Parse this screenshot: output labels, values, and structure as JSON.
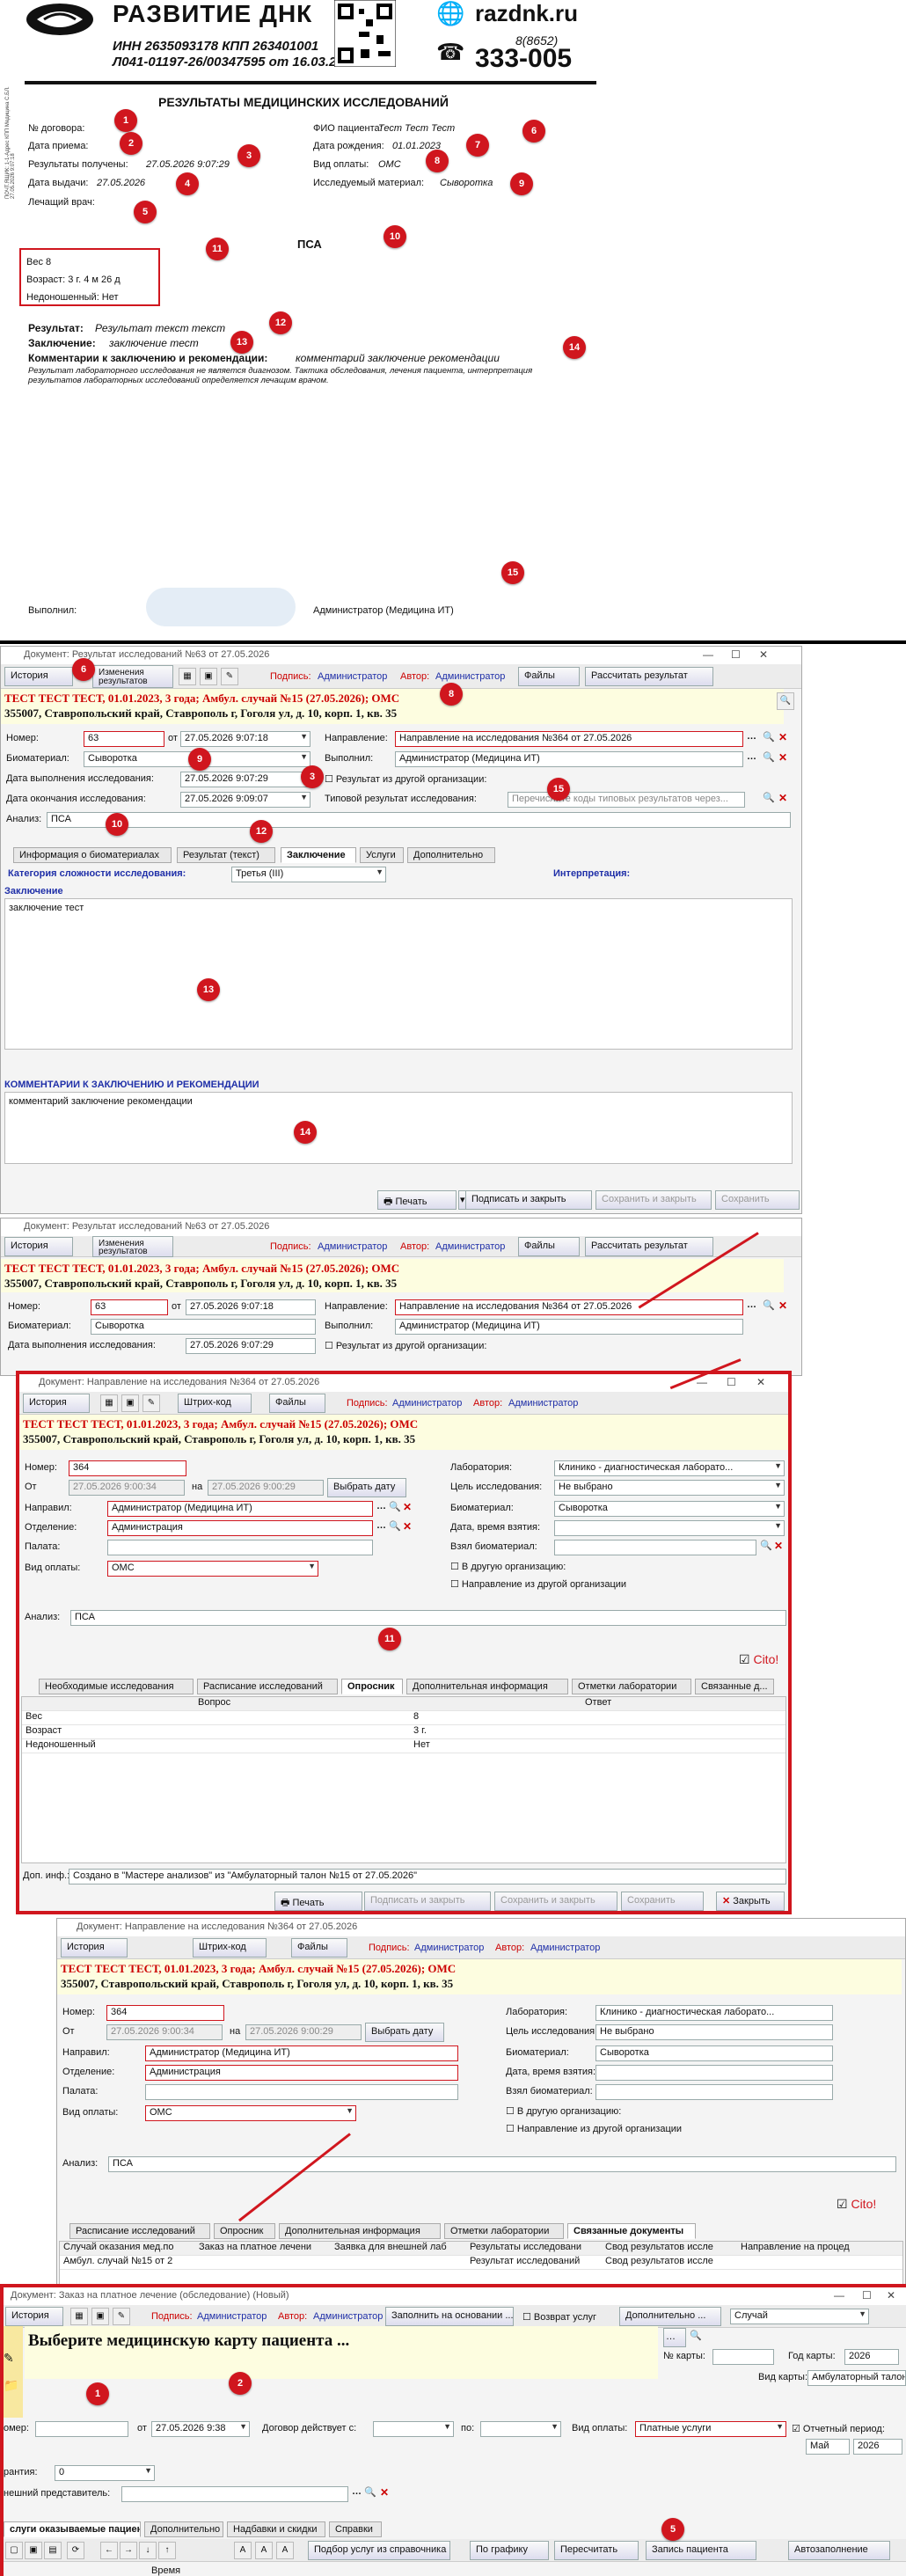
{
  "doc": {
    "brand": "РАЗВИТИЕ ДНК",
    "inn": "ИНН 2635093178 КПП 263401001",
    "license": "Л041-01197-26/00347595 от 16.03.2020г.",
    "site": "razdnk.ru",
    "phone_code": "8(8652)",
    "phone": "333-005",
    "title": "РЕЗУЛЬТАТЫ МЕДИЦИНСКИХ ИССЛЕДОВАНИЙ",
    "side_text": "ПОЧТ.ЯЩИК: 1-1-Адрес КПП Медицина С.БЛ. 27.05.2026 9:07:18",
    "l_contract": "№ договора:",
    "l_date_recv": "Дата приема:",
    "l_results_recv": "Результаты получены:",
    "results_recv": "27.05.2026 9:07:29",
    "l_issue": "Дата выдачи:",
    "issue": "27.05.2026",
    "l_doctor": "Лечащий врач:",
    "l_patient": "ФИО пациента:",
    "patient": "Тест Тест Тест",
    "l_birth": "Дата рождения:",
    "birth": "01.01.2023",
    "l_pay": "Вид оплаты:",
    "pay": "ОМС",
    "l_material": "Исследуемый материал:",
    "material": "Сыворотка",
    "analysis": "ПСА",
    "box": [
      "Вес 8",
      "Возраст: 3 г. 4 м 26 д",
      "Недоношенный: Нет"
    ],
    "l_result": "Результат:",
    "result": "Результат текст текст",
    "l_concl": "Заключение:",
    "concl": "заключение тест",
    "l_comm": "Комментарии к заключению и рекомендации:",
    "comm": "комментарий заключение рекомендации",
    "disclaimer": "Результат лабораторного исследования не является диагнозом. Тактика обследования, лечения пациента, интерпретация результатов лабораторных исследований определяется лечащим врачом.",
    "l_done": "Выполнил:",
    "done_by": "Администратор (Медицина ИТ)"
  },
  "w1": {
    "title": "Документ: Результат исследований №63 от 27.05.2026",
    "history": "История",
    "changes": "Изменения результатов",
    "l_sign": "Подпись:",
    "sign": "Администратор",
    "l_author": "Автор:",
    "author": "Администратор",
    "files": "Файлы",
    "recalc": "Рассчитать результат",
    "hdr1": "ТЕСТ ТЕСТ ТЕСТ, 01.01.2023, 3 года; Амбул. случай №15 (27.05.2026); ОМС",
    "hdr2": "355007, Ставропольский край, Ставрополь г, Гоголя ул, д. 10, корп. 1, кв. 35",
    "l_num": "Номер:",
    "num": "63",
    "l_from": "от",
    "from": "27.05.2026 9:07:18",
    "l_dir": "Направление:",
    "dir": "Направление на исследования №364 от 27.05.2026",
    "l_bio": "Биоматериал:",
    "bio": "Сыворотка",
    "l_exec": "Выполнил:",
    "exec": "Администратор (Медицина ИТ)",
    "l_date_exec": "Дата выполнения исследования:",
    "date_exec": "27.05.2026 9:07:29",
    "l_other": "Результат из другой организации:",
    "l_date_end": "Дата окончания исследования:",
    "date_end": "27.05.2026 9:09:07",
    "l_typical": "Типовой результат исследования:",
    "typical_ph": "Перечислите коды типовых результатов через...",
    "l_analysis": "Анализ:",
    "analysis": "ПСА",
    "tabs": [
      "Информация о биоматериалах",
      "Результат (текст)",
      "Заключение",
      "Услуги",
      "Дополнительно"
    ],
    "l_cat": "Категория сложности исследования:",
    "cat": "Третья (III)",
    "interp": "Интерпретация:",
    "concl_head": "Заключение",
    "concl": "заключение тест",
    "comm_head": "КОММЕНТАРИИ К ЗАКЛЮЧЕНИЮ И РЕКОМЕНДАЦИИ",
    "comm": "комментарий заключение рекомендации",
    "print": "Печать",
    "sign_close": "Подписать и закрыть",
    "save_close": "Сохранить и закрыть",
    "save": "Сохранить"
  },
  "w2": {
    "title": "Документ: Направление на исследования №364 от 27.05.2026",
    "history": "История",
    "barcode": "Штрих-код",
    "files": "Файлы",
    "l_sign": "Подпись:",
    "sign": "Администратор",
    "l_author": "Автор:",
    "author": "Администратор",
    "hdr1": "ТЕСТ ТЕСТ ТЕСТ, 01.01.2023, 3 года; Амбул. случай №15 (27.05.2026); ОМС",
    "hdr2": "355007, Ставропольский край, Ставрополь г, Гоголя ул, д. 10, корп. 1, кв. 35",
    "l_num": "Номер:",
    "num": "364",
    "l_from": "От",
    "from": "27.05.2026 9:00:34",
    "l_to": "на",
    "to": "27.05.2026 9:00:29",
    "pick": "Выбрать дату",
    "l_sent": "Направил:",
    "sent": "Администратор (Медицина ИТ)",
    "l_dept": "Отделение:",
    "dept": "Администрация",
    "l_ward": "Палата:",
    "l_pay": "Вид оплаты:",
    "pay": "ОМС",
    "l_lab": "Лаборатория:",
    "lab": "Клинико - диагностическая лаборато...",
    "l_goal": "Цель исследования:",
    "goal": "Не выбрано",
    "l_bio": "Биоматериал:",
    "bio": "Сыворотка",
    "l_take": "Дата, время взятия:",
    "l_took": "Взял биоматериал:",
    "other_org": "В другую организацию:",
    "other_dir": "Направление из другой организации",
    "l_analysis": "Анализ:",
    "analysis": "ПСА",
    "cito": "Cito!",
    "tabs": [
      "Необходимые исследования",
      "Расписание исследований",
      "Опросник",
      "Дополнительная информация",
      "Отметки лаборатории",
      "Связанные д..."
    ],
    "col_q": "Вопрос",
    "col_a": "Ответ",
    "rows": [
      [
        "Вес",
        "8"
      ],
      [
        "Возраст",
        "3   г."
      ],
      [
        "Недоношенный",
        "Нет"
      ]
    ],
    "l_extra": "Доп. инф.:",
    "extra": "Создано в \"Мастере анализов\" из \"Амбулаторный талон №15 от 27.05.2026\"",
    "print": "Печать",
    "sign_close": "Подписать и закрыть",
    "save_close": "Сохранить и закрыть",
    "save": "Сохранить",
    "close": "Закрыть"
  },
  "w3": {
    "tabs": [
      "Расписание исследований",
      "Опросник",
      "Дополнительная информация",
      "Отметки лаборатории",
      "Связанные документы"
    ],
    "cols": [
      "Случай оказания мед.по",
      "Заказ на платное лечени",
      "Заявка для внешней лаб",
      "Результаты исследовани",
      "Свод результатов иссле",
      "Направление на процед"
    ],
    "row1": "Амбул. случай №15 от 2",
    "row4": "Результат исследований",
    "row5": "Свод результатов иссле"
  },
  "w4": {
    "title": "Документ: Заказ на платное лечение (обследование) (Новый)",
    "history": "История",
    "l_sign": "Подпись:",
    "sign": "Администратор",
    "l_author": "Автор:",
    "author": "Администратор",
    "fill": "Заполнить на основании ...",
    "return": "Возврат услуг",
    "extra": "Дополнительно ...",
    "case": "Случай",
    "choose": "Выберите медицинскую карту пациента ...",
    "l_card": "№ карты:",
    "l_year": "Год карты:",
    "year": "2026",
    "l_cardtype": "Вид карты:",
    "cardtype": "Амбулаторный талон",
    "l_num": "омер:",
    "l_from": "от",
    "from": "27.05.2026 9:38",
    "l_contract": "Договор действует с:",
    "l_to": "по:",
    "l_paytype": "Вид оплаты:",
    "paytype": "Платные услуги",
    "l_period": "Отчетный период:",
    "month": "Май",
    "pyear": "2026",
    "l_warranty": "рантия:",
    "warranty": "0",
    "l_rep": "нешний представитель:",
    "tabs": [
      "слуги оказываемые пациенту",
      "Дополнительно",
      "Надбавки и скидки",
      "Справки"
    ],
    "tb_pick": "Подбор услуг из справочника",
    "tb_graph": "По графику",
    "tb_recalc": "Пересчитать",
    "tb_rec": "Запись пациента",
    "tb_auto": "Автозаполнение",
    "col_time": "Время"
  },
  "markers": [
    "1",
    "2",
    "3",
    "4",
    "5",
    "6",
    "7",
    "8",
    "9",
    "10",
    "11",
    "12",
    "13",
    "14",
    "15"
  ]
}
